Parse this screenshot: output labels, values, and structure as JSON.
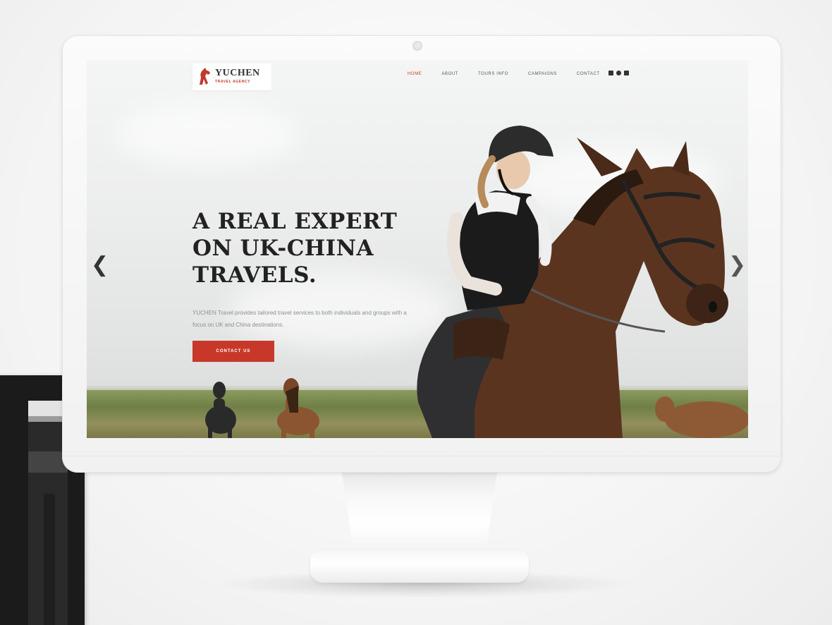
{
  "logo": {
    "name": "YUCHEN",
    "tagline": "TRAVEL AGENCY",
    "brand_color": "#c0392b"
  },
  "nav": {
    "items": [
      {
        "label": "HOME",
        "active": true
      },
      {
        "label": "ABOUT",
        "active": false
      },
      {
        "label": "TOURS INFO",
        "active": false
      },
      {
        "label": "CAMPAIGNS",
        "active": false
      },
      {
        "label": "CONTACT",
        "active": false
      }
    ],
    "social_icons": [
      "facebook-icon",
      "instagram-icon",
      "mail-icon"
    ]
  },
  "hero": {
    "title": "A REAL EXPERT\nON UK-CHINA\nTRAVELS.",
    "description": "YUCHEN Travel provides tailored travel services to both individuals and groups with a focus on UK and China destinations.",
    "cta_label": "CONTACT US",
    "cta_color": "#c8382a"
  },
  "carousel": {
    "prev_icon": "chevron-left-icon",
    "next_icon": "chevron-right-icon"
  }
}
